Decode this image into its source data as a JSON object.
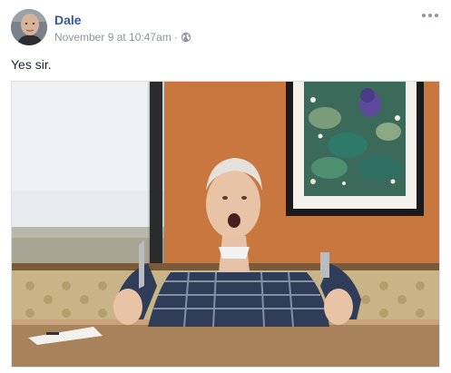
{
  "post": {
    "author": "Dale",
    "timestamp": "November 9 at 10:47am",
    "separator": "·",
    "privacy_icon": "globe-icon",
    "more_icon": "more-options-icon",
    "text": "Yes sir.",
    "photo": {
      "description_icon": "shared-photo"
    }
  },
  "colors": {
    "author_link": "#365899",
    "meta_text": "#90949c",
    "body_text": "#1d2129"
  }
}
